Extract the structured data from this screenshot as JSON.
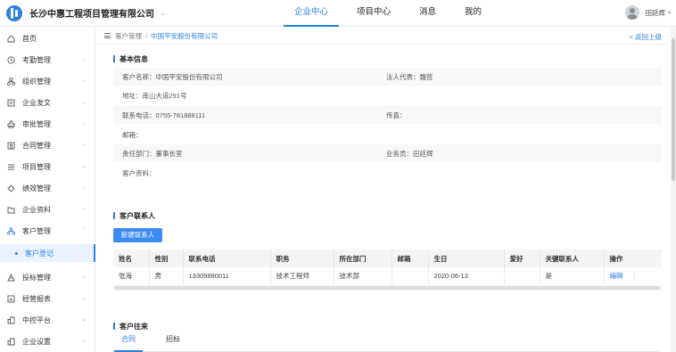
{
  "header": {
    "company": "长沙中惠工程项目管理有限公司",
    "nav": [
      "企业中心",
      "项目中心",
      "消息",
      "我的"
    ],
    "active_nav": "企业中心",
    "user_name": "田廷辉"
  },
  "sidebar": {
    "items": [
      {
        "label": "首页",
        "icon": "home-icon"
      },
      {
        "label": "考勤管理",
        "icon": "clock-icon"
      },
      {
        "label": "组织管理",
        "icon": "org-icon"
      },
      {
        "label": "企业发文",
        "icon": "document-icon"
      },
      {
        "label": "审批管理",
        "icon": "stamp-icon"
      },
      {
        "label": "合同管理",
        "icon": "contract-icon"
      },
      {
        "label": "项目管理",
        "icon": "list-icon"
      },
      {
        "label": "绩效管理",
        "icon": "performance-icon"
      },
      {
        "label": "企业资料",
        "icon": "folder-icon"
      },
      {
        "label": "客户管理",
        "icon": "customer-icon"
      },
      {
        "label": "客户登记",
        "icon": "dot-icon"
      },
      {
        "label": "投标管理",
        "icon": "bid-icon"
      },
      {
        "label": "经营报表",
        "icon": "report-icon"
      },
      {
        "label": "中控平台",
        "icon": "platform-icon"
      },
      {
        "label": "企业设置",
        "icon": "settings-icon"
      }
    ]
  },
  "breadcrumb": {
    "parent": "客户管理",
    "separator": "/",
    "current": "中国平安股份有限公司",
    "back": "< 返回上级"
  },
  "basic": {
    "title": "基本信息",
    "customer_name": "客户名称：中国平安股份有限公司",
    "legal_rep": "法人代表：魏哲",
    "address": "地址：南山大道291号",
    "phone": "联系电话：0755-781888111",
    "fax": "传真：",
    "email": "邮箱：",
    "dept": "责任部门：董事长室",
    "salesman": "业务员：田廷辉",
    "materials": "客户资料："
  },
  "contacts": {
    "title": "客户联系人",
    "new_button": "新建联系人",
    "columns": [
      "姓名",
      "性别",
      "联系电话",
      "职务",
      "所在部门",
      "邮箱",
      "生日",
      "爱好",
      "关键联系人",
      "操作"
    ],
    "rows": [
      [
        "张海",
        "男",
        "13309880011",
        "技术工程师",
        "技术部",
        "",
        "2020-06-13",
        "",
        "是",
        "编辑"
      ]
    ],
    "more": "⋮"
  },
  "dealings": {
    "title": "客户往来",
    "tabs": [
      "合同",
      "招标"
    ]
  },
  "colors": {
    "accent": "#2f7fe0",
    "button": "#3d8bf2"
  }
}
